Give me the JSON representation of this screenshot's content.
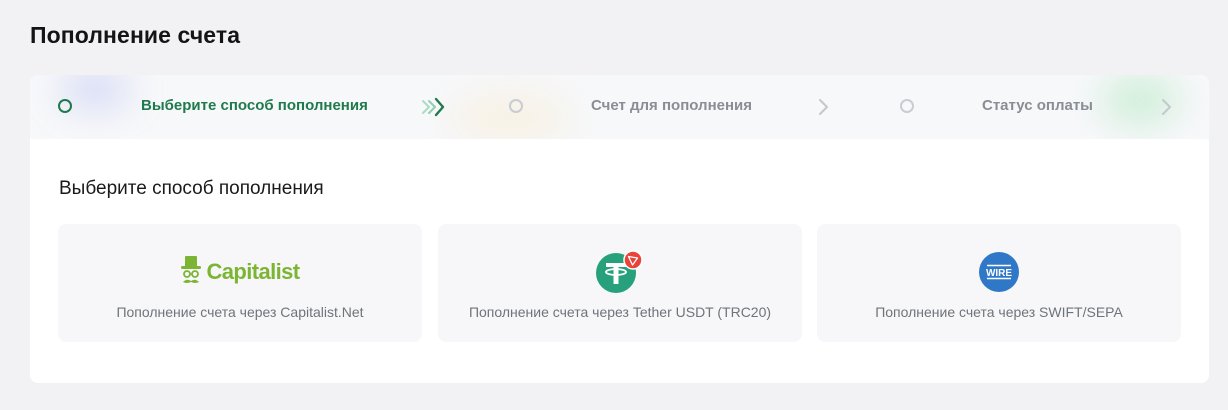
{
  "page": {
    "title": "Пополнение счета"
  },
  "stepper": {
    "steps": [
      {
        "label": "Выберите способ пополнения",
        "state": "active"
      },
      {
        "label": "Счет для пополнения",
        "state": "pending"
      },
      {
        "label": "Статус оплаты",
        "state": "pending"
      }
    ]
  },
  "section": {
    "title": "Выберите способ пополнения"
  },
  "methods": [
    {
      "logo_text": "Capitalist",
      "label": "Пополнение счета через Capitalist.Net",
      "icon": "capitalist-logo"
    },
    {
      "label": "Пополнение счета через Tether USDT (TRC20)",
      "icon": "tether-usdt-trc20-icon"
    },
    {
      "logo_text": "WIRE",
      "label": "Пополнение счета через SWIFT/SEPA",
      "icon": "wire-transfer-icon"
    }
  ],
  "colors": {
    "accent_green": "#1f7a4d",
    "capitalist_green": "#7cb533",
    "tether_green": "#26a17b",
    "tron_red": "#e8443a",
    "wire_blue": "#2f78c8"
  }
}
